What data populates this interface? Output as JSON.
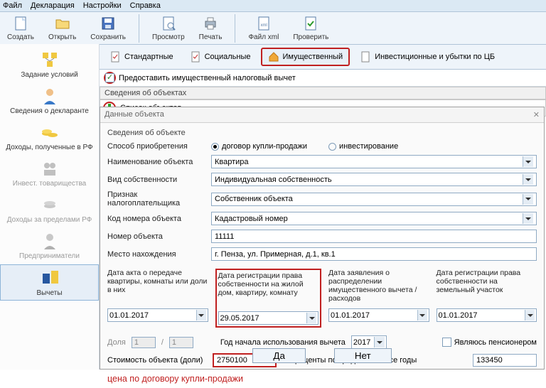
{
  "menu": {
    "file": "Файл",
    "declaration": "Декларация",
    "settings": "Настройки",
    "help": "Справка"
  },
  "toolbar": {
    "create": "Создать",
    "open": "Открыть",
    "save": "Сохранить",
    "preview": "Просмотр",
    "print": "Печать",
    "filexml": "Файл xml",
    "check": "Проверить"
  },
  "tabs": {
    "standard": "Стандартные",
    "social": "Социальные",
    "property": "Имущественный",
    "invest": "Инвестиционные и убытки по ЦБ"
  },
  "chk_provide": "Предоставить имущественный налоговый вычет",
  "section_objects": "Сведения об объектах",
  "list_objects": "Список объектов",
  "sidebar": {
    "task": "Задание условий",
    "declarant": "Сведения о декларанте",
    "income_rf": "Доходы, полученные в РФ",
    "invest_p": "Инвест. товарищества",
    "income_ab": "Доходы за пределами РФ",
    "entrep": "Предприниматели",
    "deduct": "Вычеты"
  },
  "dialog": {
    "title": "Данные объекта",
    "section": "Сведения об объекте",
    "acq_label": "Способ приобретения",
    "acq_sale": "договор купли-продажи",
    "acq_invest": "инвестирование",
    "name_label": "Наименование объекта",
    "name_value": "Квартира",
    "ownership_label": "Вид собственности",
    "ownership_value": "Индивидуальная собственность",
    "taxpayer_label": "Признак налогоплательщика",
    "taxpayer_value": "Собственник объекта",
    "code_label": "Код номера объекта",
    "code_value": "Кадастровый номер",
    "num_label": "Номер объекта",
    "num_value": "11111",
    "loc_label": "Место нахождения",
    "loc_value": "г. Пенза, ул. Примерная, д.1, кв.1",
    "date1_label": "Дата акта о передаче квартиры, комнаты или доли в них",
    "date1_value": "01.01.2017",
    "date2_label": "Дата регистрации права собственности на жилой дом, квартиру, комнату",
    "date2_value": "29.05.2017",
    "date3_label": "Дата заявления о распределении имущественного вычета / расходов",
    "date3_value": "01.01.2017",
    "date4_label": "Дата регистрации права собственности на земельный участок",
    "date4_value": "01.01.2017",
    "share_label": "Доля",
    "share_a": "1",
    "share_b": "1",
    "year_label": "Год начала использования вычета",
    "year_value": "2017",
    "pension_label": "Являюсь пенсионером",
    "cost_label": "Стоимость объекта (доли)",
    "cost_value": "2750100",
    "interest_label": "Проценты по кредитам за все годы",
    "interest_value": "133450",
    "annotation": "цена по договору купли-продажи",
    "yes": "Да",
    "no": "Нет"
  }
}
